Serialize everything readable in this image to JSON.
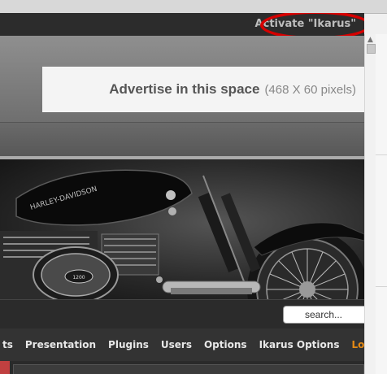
{
  "header": {
    "activate_link": "Activate \"Ikarus\""
  },
  "ad": {
    "main": "Advertise in this space",
    "sub": "(468 X 60 pixels)"
  },
  "banner": {
    "brand_text": "HARLEY-DAVIDSON",
    "badge_text": "1200"
  },
  "search": {
    "placeholder": "search..."
  },
  "menu": {
    "items": [
      "ts",
      "Presentation",
      "Plugins",
      "Users",
      "Options",
      "Ikarus Options"
    ],
    "logout": "Logout"
  },
  "colors": {
    "highlight": "#d60000",
    "logout": "#e58a14"
  }
}
